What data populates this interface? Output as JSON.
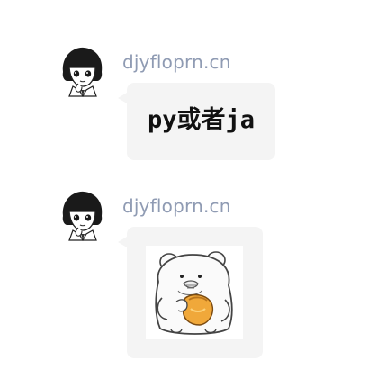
{
  "messages": [
    {
      "sender": "djyfloprn.cn",
      "avatar_icon": "anime-girl-avatar-icon",
      "type": "text",
      "text": "py或者ja"
    },
    {
      "sender": "djyfloprn.cn",
      "avatar_icon": "anime-girl-avatar-icon",
      "type": "sticker",
      "sticker_icon": "bear-holding-honey-jar-sticker-icon"
    }
  ],
  "colors": {
    "background": "#ffffff",
    "bubble": "#f4f4f4",
    "sender_name": "#8f9bb3",
    "message_text": "#111111",
    "honey": "#f0a83a"
  }
}
